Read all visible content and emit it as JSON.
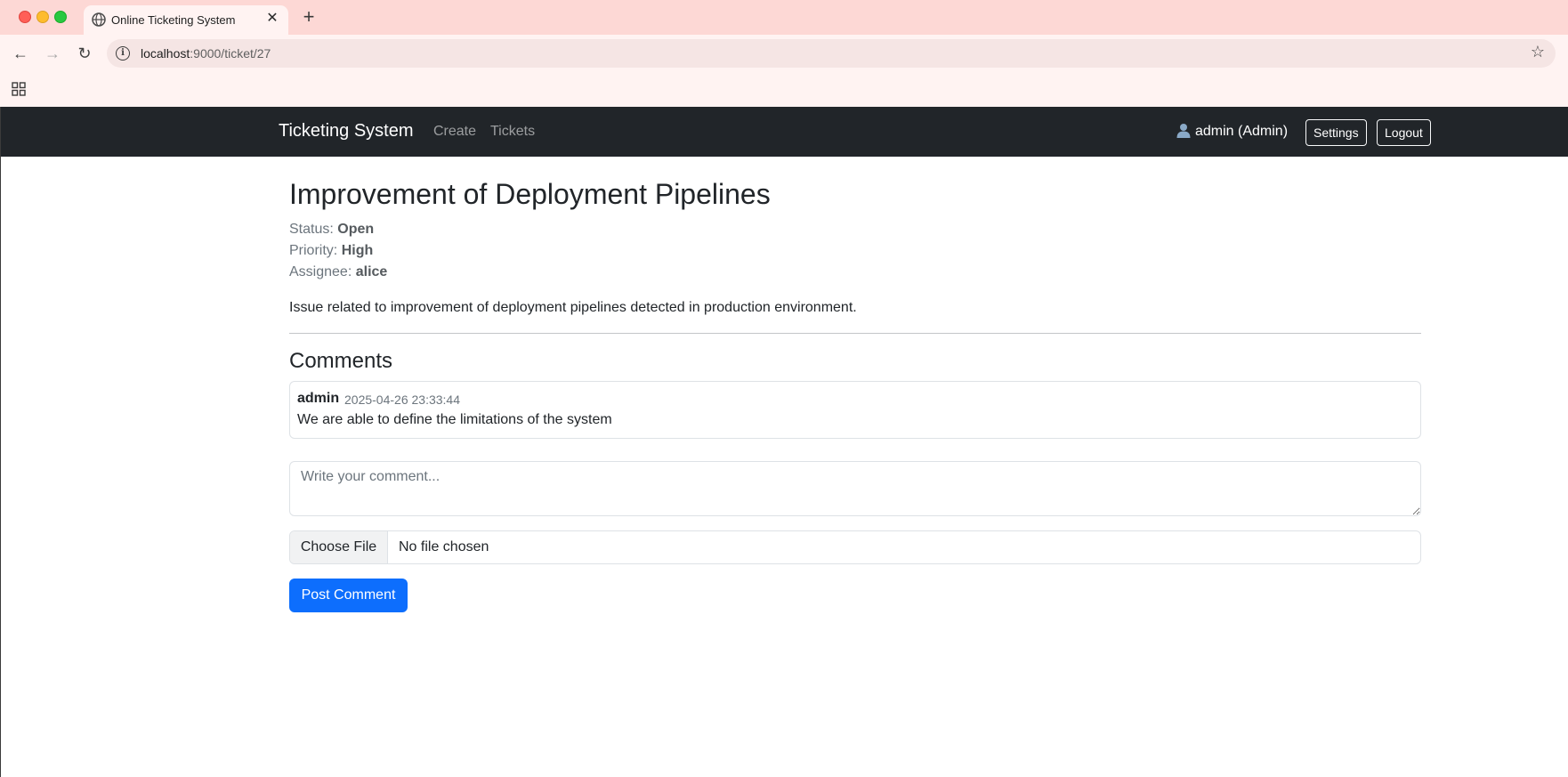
{
  "browser": {
    "tab_title": "Online Ticketing System",
    "tab_close": "✕",
    "new_tab": "+",
    "url_host": "localhost",
    "url_path": ":9000/ticket/27",
    "back": "←",
    "forward": "→",
    "reload": "↻",
    "star": "☆",
    "icons": [
      "globe-icon",
      "info-icon",
      "star-icon",
      "apps-icon",
      "back-arrow-icon",
      "forward-arrow-icon",
      "reload-icon"
    ]
  },
  "navbar": {
    "brand": "Ticketing System",
    "links": [
      {
        "label": "Create"
      },
      {
        "label": "Tickets"
      }
    ],
    "user": "admin (Admin)",
    "settings_label": "Settings",
    "logout_label": "Logout"
  },
  "ticket": {
    "title": "Improvement of Deployment Pipelines",
    "status_label": "Status:",
    "status": "Open",
    "priority_label": "Priority:",
    "priority": "High",
    "assignee_label": "Assignee:",
    "assignee": "alice",
    "description": "Issue related to improvement of deployment pipelines detected in production environment."
  },
  "comments": {
    "heading": "Comments",
    "items": [
      {
        "author": "admin",
        "timestamp": "2025-04-26 23:33:44",
        "text": "We are able to define the limitations of the system"
      }
    ],
    "input_placeholder": "Write your comment...",
    "file_button": "Choose File",
    "file_status": "No file chosen",
    "submit_label": "Post Comment"
  },
  "colors": {
    "navbar_bg": "#212529",
    "primary": "#0d6efd",
    "tabstrip_bg": "#fdd8d5",
    "toolbar_bg": "#fff3f2"
  }
}
